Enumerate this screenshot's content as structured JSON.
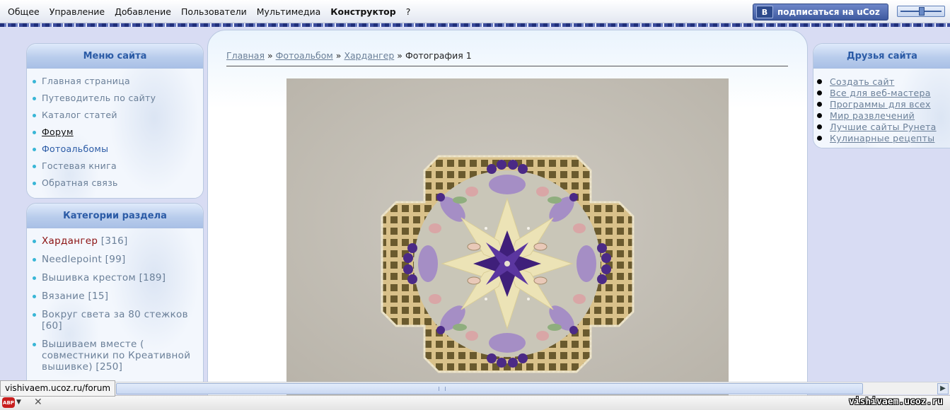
{
  "topbar": {
    "menu": [
      "Общее",
      "Управление",
      "Добавление",
      "Пользователи",
      "Мультимедиа",
      "Конструктор",
      "?"
    ],
    "subscribe_label": "подписаться на uCoz",
    "subscribe_icon_label": "B"
  },
  "left": {
    "menu_title": "Меню сайта",
    "menu_items": [
      "Главная страница",
      "Путеводитель по сайту",
      "Каталог статей",
      "Форум",
      "Фотоальбомы",
      "Гостевая книга",
      "Обратная связь"
    ],
    "categories_title": "Категории раздела",
    "categories": [
      {
        "name": "Хардангер",
        "count": "[316]"
      },
      {
        "name": "Needlepoint",
        "count": "[99]"
      },
      {
        "name": "Вышивка крестом",
        "count": "[189]"
      },
      {
        "name": "Вязание",
        "count": "[15]"
      },
      {
        "name": "Вокруг света за 80 стежков",
        "count": "[60]"
      },
      {
        "name": "Вышиваем вместе ( совместники по Креативной вышивке)",
        "count": "[250]"
      }
    ]
  },
  "content": {
    "breadcrumb": [
      "Главная",
      "Фотоальбом",
      "Хардангер"
    ],
    "breadcrumb_separator": "»",
    "breadcrumb_current": "Фотография 1"
  },
  "right": {
    "friends_title": "Друзья сайта",
    "friends": [
      "Создать сайт",
      "Все для веб-мастера",
      "Программы для всех",
      "Мир развлечений",
      "Лучшие сайты Рунета",
      "Кулинарные рецепты"
    ]
  },
  "browser": {
    "status_url": "vishivaem.ucoz.ru/forum",
    "watermark": "vishivaem.ucoz.ru",
    "abp_label": "ABP"
  },
  "colors": {
    "page_bg": "#d8dcf3",
    "panel_title": "#2b5ba6",
    "link_muted": "#6a7f98",
    "active_category": "#8b1111",
    "bullet": "#39b6d6"
  }
}
